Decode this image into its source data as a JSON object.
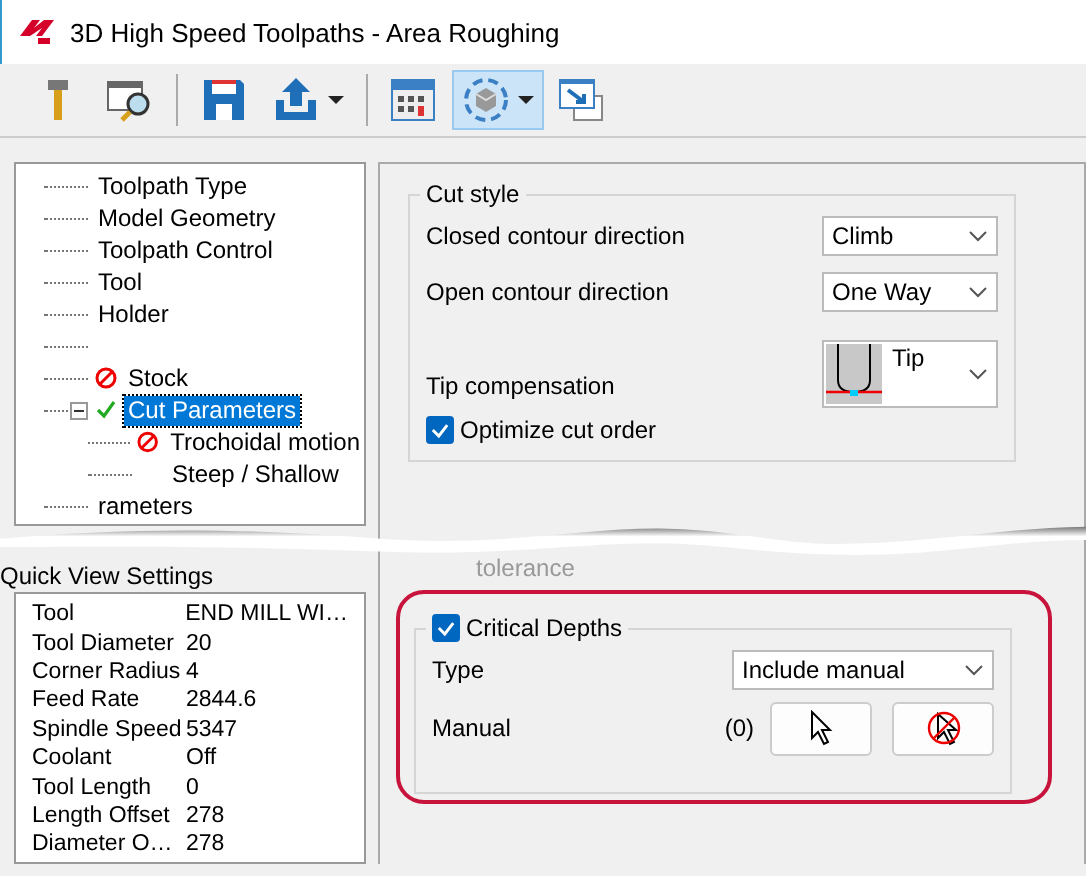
{
  "window": {
    "title": "3D High Speed Toolpaths - Area Roughing"
  },
  "toolbar": [
    {
      "selected": false,
      "dropdown": false
    },
    {
      "selected": false,
      "dropdown": false
    },
    {
      "selected": false,
      "dropdown": false
    },
    {
      "selected": false,
      "dropdown": true
    },
    {
      "selected": false,
      "dropdown": false
    },
    {
      "selected": true,
      "dropdown": true
    },
    {
      "selected": false,
      "dropdown": false
    }
  ],
  "tree": [
    {
      "label": "Toolpath Type",
      "kind": "plain",
      "selected": false
    },
    {
      "label": "Model Geometry",
      "kind": "plain",
      "selected": false
    },
    {
      "label": "Toolpath Control",
      "kind": "plain",
      "selected": false
    },
    {
      "label": "Tool",
      "kind": "plain",
      "selected": false
    },
    {
      "label": "Holder",
      "kind": "plain",
      "selected": false
    },
    {
      "kind": "blank"
    },
    {
      "label": "Stock",
      "kind": "error",
      "selected": false
    },
    {
      "label": "Cut Parameters",
      "kind": "ok",
      "selected": true,
      "expanded": true,
      "children": [
        {
          "label": "Trochoidal motion",
          "kind": "error",
          "selected": false
        },
        {
          "label": "Steep / Shallow",
          "kind": "plain",
          "selected": false
        }
      ]
    },
    {
      "label": "rameters",
      "kind": "plain",
      "selected": false
    }
  ],
  "cut_style": {
    "title": "Cut style",
    "rows": [
      {
        "label": "Closed contour direction",
        "value": "Climb",
        "kind": "select"
      },
      {
        "label": "Open contour direction",
        "value": "One Way",
        "kind": "select"
      },
      {
        "label": "Tip compensation",
        "value": "Tip",
        "kind": "image-select"
      }
    ],
    "optimize": {
      "label": "Optimize cut order",
      "checked": true
    }
  },
  "hidden_field": {
    "label": "tolerance"
  },
  "quick_view": {
    "title": "Quick View Settings",
    "rows": [
      {
        "name": "Tool",
        "value": "END MILL WI…"
      },
      {
        "name": "Tool Diameter",
        "value": "20"
      },
      {
        "name": "Corner Radius",
        "value": "4"
      },
      {
        "name": "Feed Rate",
        "value": "2844.6"
      },
      {
        "name": "Spindle Speed",
        "value": "5347"
      },
      {
        "name": "Coolant",
        "value": "Off"
      },
      {
        "name": "Tool Length",
        "value": "0"
      },
      {
        "name": "Length Offset",
        "value": "278"
      },
      {
        "name": "Diameter O…",
        "value": "278"
      }
    ]
  },
  "critical_depths": {
    "label": "Critical Depths",
    "checked": true,
    "highlighted": true,
    "type_label": "Type",
    "type_value": "Include manual",
    "manual_label": "Manual",
    "manual_count": "(0)"
  }
}
